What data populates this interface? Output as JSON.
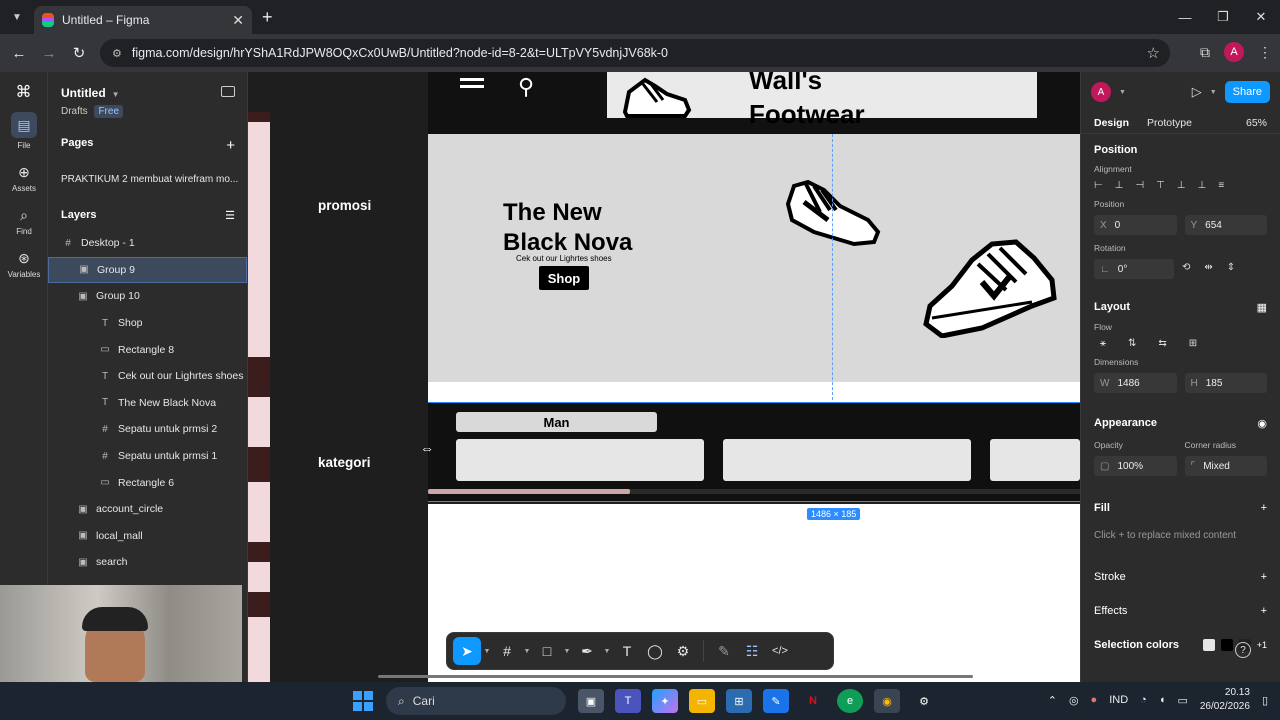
{
  "browser": {
    "tab_title": "Untitled – Figma",
    "url": "figma.com/design/hrYShA1RdJPW8OQxCx0UwB/Untitled?node-id=8-2&t=ULTpVY5vdnjJV68k-0",
    "profile_initial": "A",
    "newtab_label": "+",
    "tab_close": "✕"
  },
  "figma_rail": {
    "items": [
      {
        "label": "File"
      },
      {
        "label": "Assets"
      },
      {
        "label": "Find"
      },
      {
        "label": "Variables"
      }
    ]
  },
  "file": {
    "title": "Untitled",
    "drafts": "Drafts",
    "plan": "Free"
  },
  "pages": {
    "header": "Pages",
    "items": [
      "PRAKTIKUM 2 membuat wirefram mo..."
    ]
  },
  "layers": {
    "header": "Layers",
    "rows": [
      {
        "label": "Desktop - 1",
        "icon": "#"
      },
      {
        "label": "Group 9",
        "icon": "▣"
      },
      {
        "label": "Group 10",
        "icon": "▣"
      },
      {
        "label": "Shop",
        "icon": "T"
      },
      {
        "label": "Rectangle 8",
        "icon": "▭"
      },
      {
        "label": "Cek out our Lighrtes shoes",
        "icon": "T"
      },
      {
        "label": "The New Black Nova",
        "icon": "T"
      },
      {
        "label": "Sepatu untuk prmsi 2",
        "icon": "#"
      },
      {
        "label": "Sepatu untuk prmsi 1",
        "icon": "#"
      },
      {
        "label": "Rectangle 6",
        "icon": "▭"
      },
      {
        "label": "account_circle",
        "icon": "▣"
      },
      {
        "label": "local_mall",
        "icon": "▣"
      },
      {
        "label": "search",
        "icon": "▣"
      }
    ]
  },
  "canvas": {
    "label_promosi": "promosi",
    "label_kategori": "kategori",
    "brand_line1": "Wall's",
    "brand_line2": "Footwear",
    "promo_title_1": "The New",
    "promo_title_2": "Black Nova",
    "promo_sub": "Cek out our Lighrtes shoes",
    "shop_label": "Shop",
    "category_tab": "Man",
    "dimension_badge": "1486 × 185"
  },
  "properties": {
    "user_initial": "A",
    "share_label": "Share",
    "tab_design": "Design",
    "tab_prototype": "Prototype",
    "zoom": "65%",
    "position_header": "Position",
    "alignment_label": "Alignment",
    "position_label": "Position",
    "x_key": "X",
    "x_value": "0",
    "y_key": "Y",
    "y_value": "654",
    "rotation_label": "Rotation",
    "rotation_value": "0°",
    "layout_header": "Layout",
    "flow_label": "Flow",
    "dimensions_label": "Dimensions",
    "w_key": "W",
    "w_value": "1486",
    "h_key": "H",
    "h_value": "185",
    "appearance_header": "Appearance",
    "opacity_label": "Opacity",
    "opacity_value": "100%",
    "corner_label": "Corner radius",
    "corner_value": "Mixed",
    "fill_header": "Fill",
    "fill_hint": "Click + to replace mixed content",
    "stroke_header": "Stroke",
    "effects_header": "Effects",
    "selection_colors_header": "Selection colors",
    "selection_colors_more": "+1",
    "help": "?"
  },
  "taskbar": {
    "search_placeholder": "Cari",
    "lang": "IND",
    "time": "20.13",
    "date": "26/02/2026"
  },
  "colors": {
    "figma_blue": "#0d99ff",
    "selection": "#2d8cff",
    "panel_bg": "#2c2c2c"
  }
}
